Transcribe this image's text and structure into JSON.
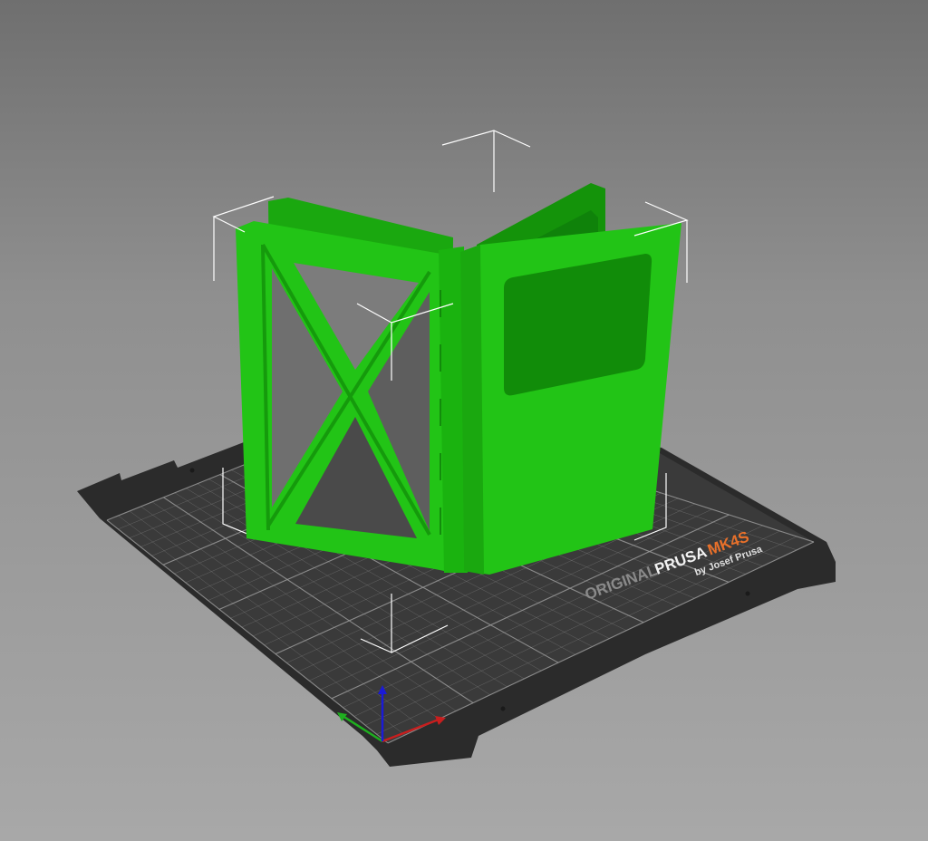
{
  "viewport": {
    "background_color": "#8f8f8f"
  },
  "bed": {
    "brand_original": "ORIGINAL",
    "brand_prusa": "PRUSA",
    "brand_model": "MK4S",
    "brand_by": "by Josef Prusa",
    "plate_color": "#2f2f2f",
    "grid_color": "#9a9a9a",
    "model_color": "#e8702a"
  },
  "model": {
    "color": "#22c416",
    "shade_color": "#159a0c",
    "dark_color": "#0e7a08"
  },
  "axes": {
    "x_color": "#c81e1e",
    "y_color": "#1fae1f",
    "z_color": "#1a1ad6"
  },
  "icons": {
    "bounding_box": "bounding-box-corners-icon",
    "axes": "xyz-axes-icon"
  }
}
